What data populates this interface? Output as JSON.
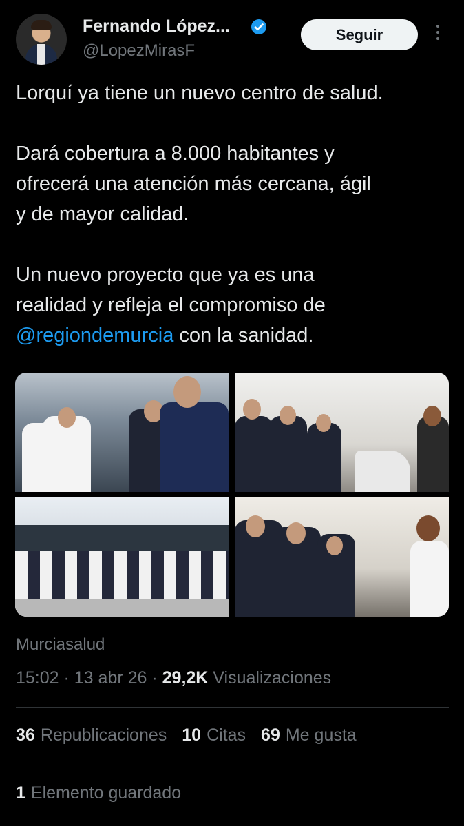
{
  "author": {
    "name": "Fernando López...",
    "handle": "@LopezMirasF",
    "follow_label": "Seguir"
  },
  "tweet": {
    "line1": "Lorquí ya tiene un nuevo centro de salud.",
    "para2": "Dará cobertura a 8.000 habitantes y\nofrecerá una atención más cercana, ágil\ny de mayor calidad.",
    "para3_start": "Un nuevo proyecto que ya es una\nrealidad y refleja el compromiso de\n",
    "mention": "@regiondemurcia",
    "para3_end": " con la sanidad."
  },
  "media": {
    "photos": [
      "photo-1",
      "photo-2",
      "photo-3",
      "photo-4"
    ]
  },
  "source": "Murciasalud",
  "meta": {
    "time": "15:02",
    "sep1": " · ",
    "date": "13 abr 26",
    "sep2": " · ",
    "views_count": "29,2K",
    "views_label": " Visualizaciones"
  },
  "stats": {
    "reposts_count": "36",
    "reposts_label": "Republicaciones",
    "quotes_count": "10",
    "quotes_label": "Citas",
    "likes_count": "69",
    "likes_label": "Me gusta"
  },
  "saved": {
    "count": "1",
    "label": "Elemento guardado"
  },
  "colors": {
    "background": "#000000",
    "text": "#e7e9ea",
    "secondary": "#71767b",
    "link": "#1d9bf0",
    "verified": "#1d9bf0"
  }
}
